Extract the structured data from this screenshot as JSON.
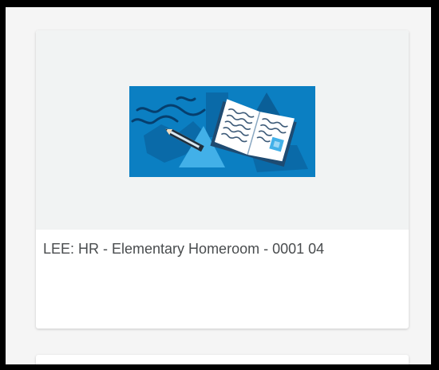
{
  "course_card": {
    "title": "LEE: HR - Elementary Homeroom - 0001 04",
    "image_icon": "open-book-with-pencil-illustration"
  },
  "colors": {
    "illustration_background": "#0b7fc2",
    "illustration_dark": "#0a5f98",
    "illustration_light": "#42b0e8",
    "card_image_background": "#f1f3f3",
    "title_text": "#494c4e"
  }
}
